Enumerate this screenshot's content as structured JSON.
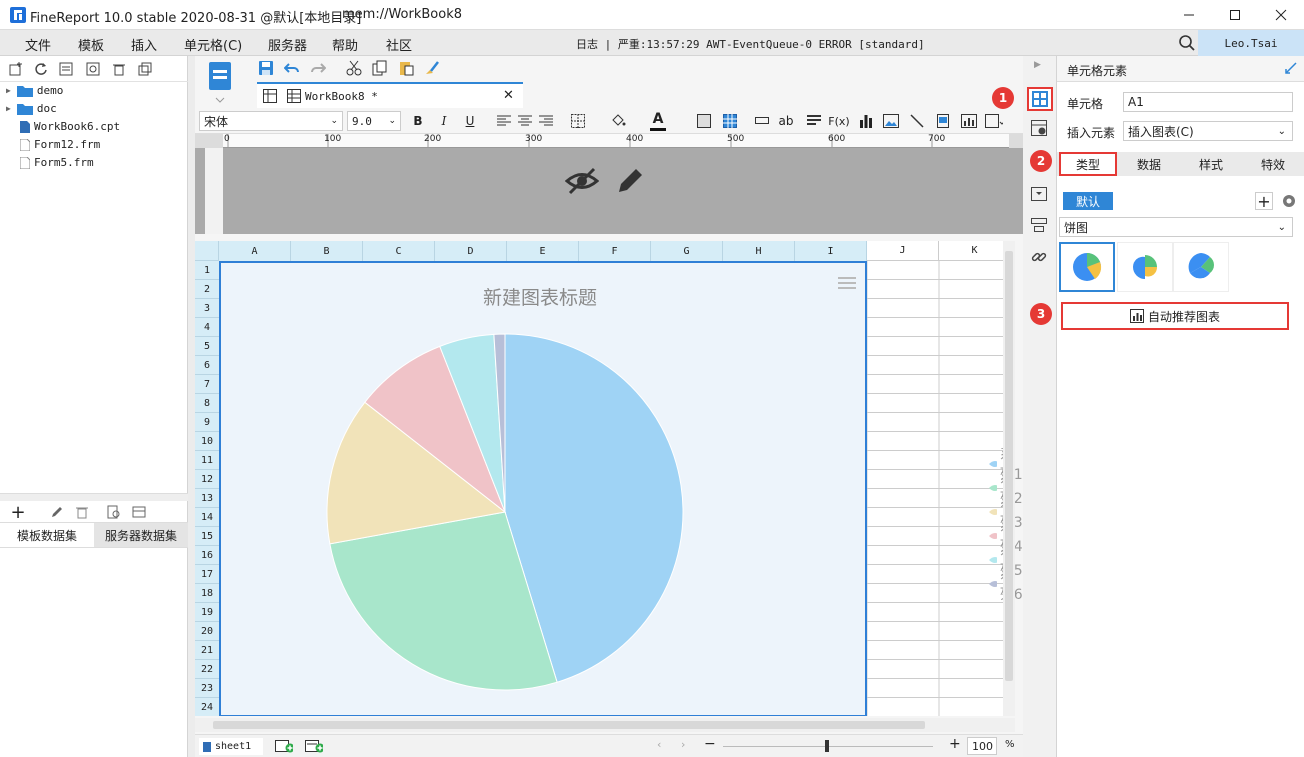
{
  "window": {
    "title": "FineReport 10.0 stable 2020-08-31 @默认[本地目录]",
    "file": "mem://WorkBook8"
  },
  "menu": [
    "文件",
    "模板",
    "插入",
    "单元格(C)",
    "服务器",
    "帮助",
    "社区"
  ],
  "log": "日志 | 严重:13:57:29 AWT-EventQueue-0 ERROR [standard]",
  "user": "Leo.Tsai",
  "tree": [
    {
      "name": "demo",
      "type": "folder"
    },
    {
      "name": "doc",
      "type": "folder"
    },
    {
      "name": "WorkBook6.cpt",
      "type": "cpt"
    },
    {
      "name": "Form12.frm",
      "type": "frm"
    },
    {
      "name": "Form5.frm",
      "type": "frm"
    }
  ],
  "dataset_tabs": [
    "模板数据集",
    "服务器数据集"
  ],
  "doc_tab": "WorkBook8 *",
  "font": {
    "name": "宋体",
    "size": "9.0"
  },
  "format_buttons": {
    "bold": "B",
    "italic": "I",
    "underline": "U",
    "formula": "F(x)",
    "ab": "ab"
  },
  "ruler": [
    "0",
    "100",
    "200",
    "300",
    "400",
    "500",
    "600",
    "700"
  ],
  "columns": [
    "A",
    "B",
    "C",
    "D",
    "E",
    "F",
    "G",
    "H",
    "I",
    "J",
    "K"
  ],
  "rows": [
    "1",
    "2",
    "3",
    "4",
    "5",
    "6",
    "7",
    "8",
    "9",
    "10",
    "11",
    "12",
    "13",
    "14",
    "15",
    "16",
    "17",
    "18",
    "19",
    "20",
    "21",
    "22",
    "23",
    "24"
  ],
  "chart_data": {
    "type": "pie",
    "title": "新建图表标题",
    "categories": [
      "系列1",
      "系列2",
      "系列3",
      "系列4",
      "系列5",
      "系列6"
    ],
    "values": [
      45.5,
      27,
      13.5,
      8.5,
      5,
      1
    ],
    "colors": [
      "#9fd3f5",
      "#a8e6cb",
      "#f1e3b9",
      "#f0c3c8",
      "#b3e8ee",
      "#b7bfd8"
    ],
    "legend": "right"
  },
  "sheet": {
    "name": "sheet1",
    "zoom": "100",
    "zoom_unit": "%"
  },
  "right": {
    "header": "单元格元素",
    "cell_label": "单元格",
    "cell_value": "A1",
    "insert_label": "插入元素",
    "insert_value": "插入图表(C)",
    "tabs": [
      "类型",
      "数据",
      "样式",
      "特效"
    ],
    "default_tag": "默认",
    "chart_type": "饼图",
    "recommend": "自动推荐图表"
  },
  "badges": [
    "1",
    "2",
    "3"
  ]
}
